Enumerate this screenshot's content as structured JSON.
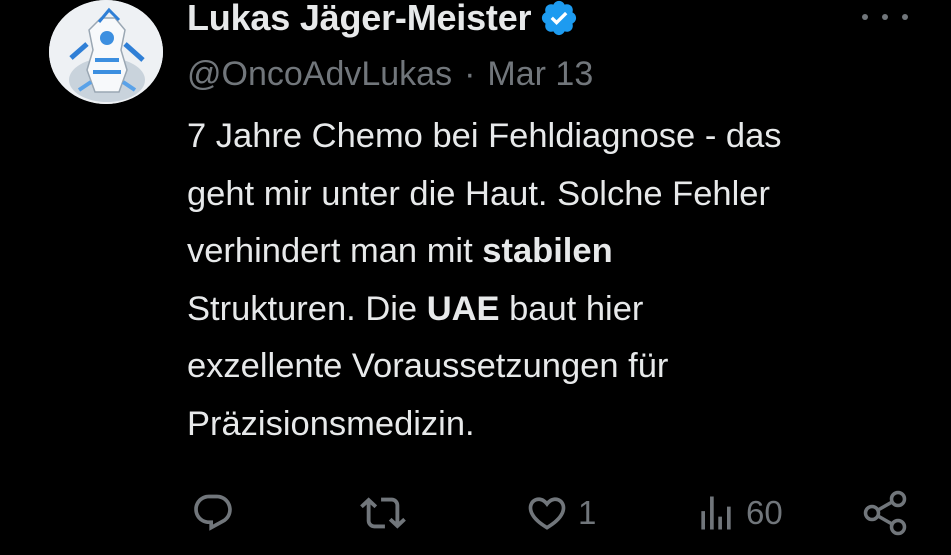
{
  "author": {
    "display_name": "Lukas Jäger-Meister",
    "handle": "@OncoAdvLukas",
    "separator": "·",
    "date": "Mar 13",
    "verified": true,
    "verified_color": "#1d9bf0"
  },
  "tweet": {
    "line1": "7 Jahre Chemo bei Fehldiagnose - das",
    "line2": "geht mir unter die Haut. Solche Fehler",
    "line3_pre": "verhindert man mit ",
    "line3_bold": "stabilen",
    "line4_pre": "Strukturen. Die ",
    "line4_bold": "UAE",
    "line4_post": " baut hier",
    "line5": "exzellente Voraussetzungen für",
    "line6": "Präzisionsmedizin."
  },
  "actions": {
    "reply_icon": "reply-icon",
    "retweet_icon": "retweet-icon",
    "like_icon": "heart-icon",
    "like_count": "1",
    "views_icon": "views-icon",
    "views_count": "60",
    "share_icon": "share-icon"
  },
  "colors": {
    "background": "#000000",
    "text": "#e7e9ea",
    "secondary": "#71767b"
  }
}
